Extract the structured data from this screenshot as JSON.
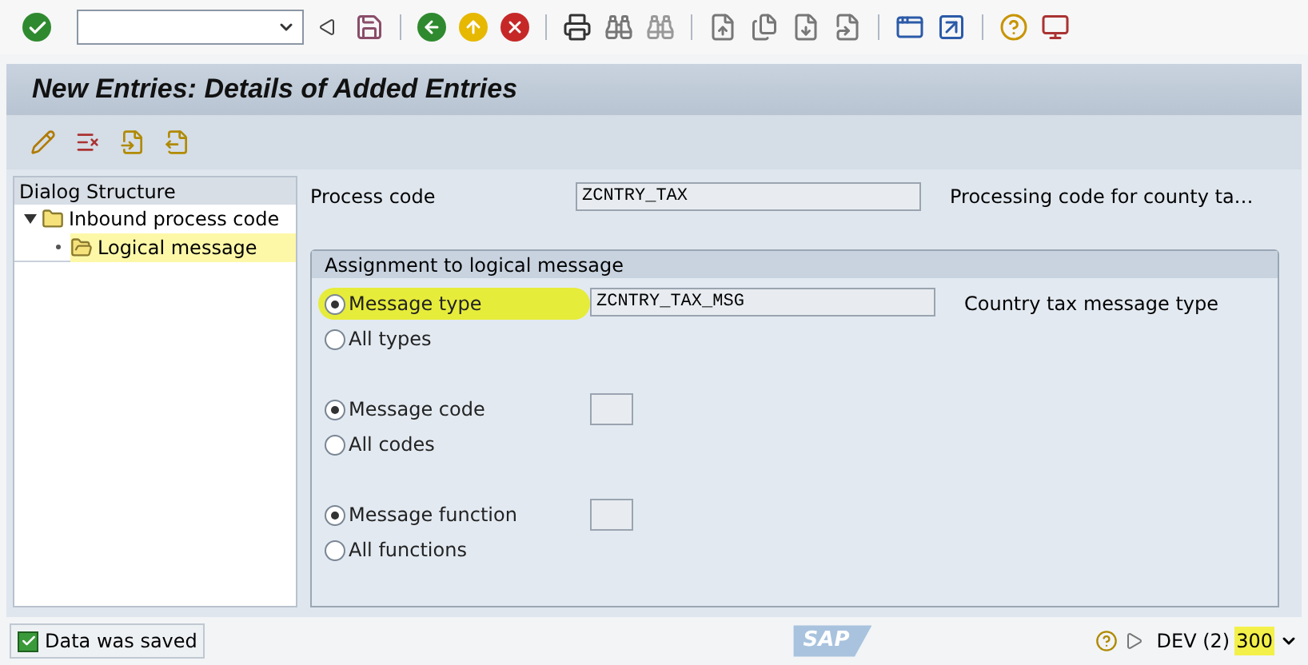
{
  "title": "New Entries: Details of Added Entries",
  "dialog_structure": {
    "title": "Dialog Structure",
    "tree": [
      {
        "label": "Inbound process code",
        "expanded": true,
        "selected": false,
        "children": [
          {
            "label": "Logical message",
            "selected": true
          }
        ]
      }
    ]
  },
  "process_code": {
    "label": "Process code",
    "value": "ZCNTRY_TAX",
    "description": "Processing code for county ta…"
  },
  "assignment": {
    "title": "Assignment to logical message",
    "groups": [
      {
        "options": [
          {
            "label": "Message type",
            "selected": true,
            "highlighted": true
          },
          {
            "label": "All types",
            "selected": false,
            "highlighted": false
          }
        ],
        "field": {
          "kind": "long",
          "value": "ZCNTRY_TAX_MSG",
          "description": "Country tax message type"
        }
      },
      {
        "options": [
          {
            "label": "Message code",
            "selected": true,
            "highlighted": false
          },
          {
            "label": "All codes",
            "selected": false,
            "highlighted": false
          }
        ],
        "field": {
          "kind": "short"
        }
      },
      {
        "options": [
          {
            "label": "Message function",
            "selected": true,
            "highlighted": false
          },
          {
            "label": "All functions",
            "selected": false,
            "highlighted": false
          }
        ],
        "field": {
          "kind": "short"
        }
      }
    ]
  },
  "status_bar": {
    "message": "Data was saved",
    "logo": "SAP",
    "system": "DEV (2)",
    "client": "300",
    "client_highlighted": true
  }
}
